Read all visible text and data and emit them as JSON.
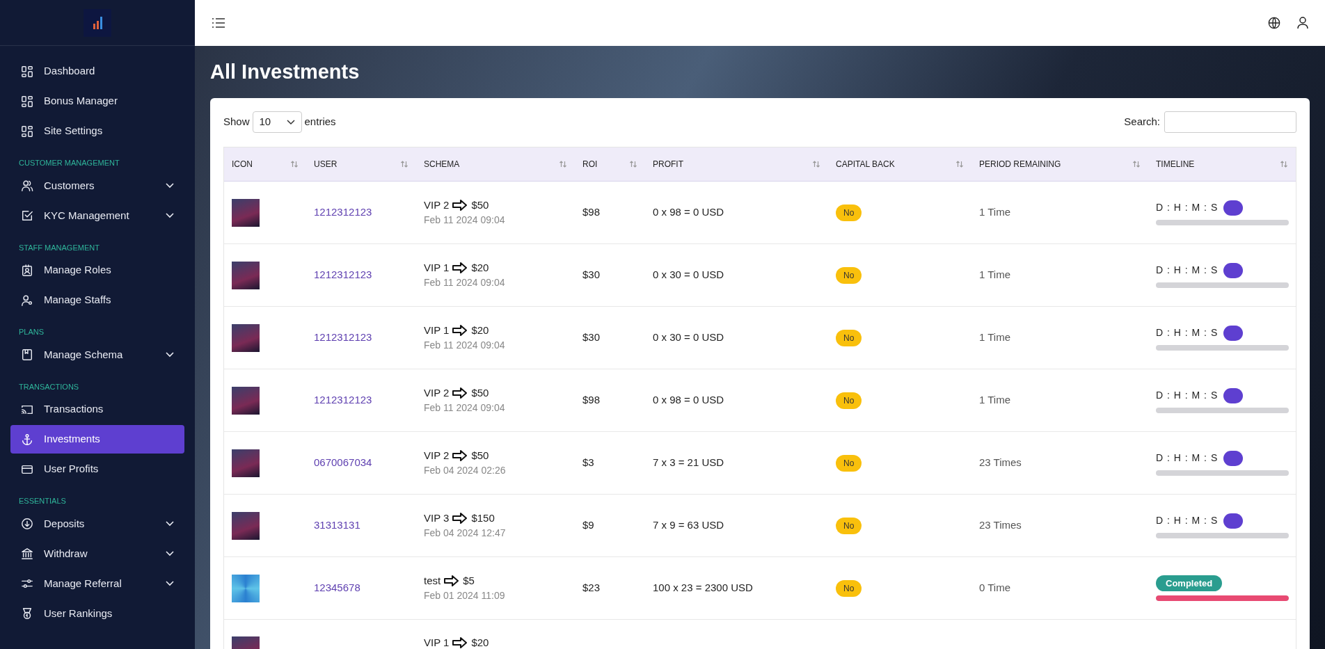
{
  "sidebar": {
    "items": [
      {
        "kind": "link",
        "label": "Dashboard",
        "selected": false
      },
      {
        "kind": "link",
        "label": "Bonus Manager",
        "selected": false
      },
      {
        "kind": "link",
        "label": "Site Settings",
        "selected": false
      },
      {
        "kind": "section",
        "label": "CUSTOMER MANAGEMENT"
      },
      {
        "kind": "link",
        "label": "Customers",
        "selected": false,
        "expandable": true
      },
      {
        "kind": "link",
        "label": "KYC Management",
        "selected": false,
        "expandable": true
      },
      {
        "kind": "section",
        "label": "STAFF MANAGEMENT"
      },
      {
        "kind": "link",
        "label": "Manage Roles",
        "selected": false
      },
      {
        "kind": "link",
        "label": "Manage Staffs",
        "selected": false
      },
      {
        "kind": "section",
        "label": "PLANS"
      },
      {
        "kind": "link",
        "label": "Manage Schema",
        "selected": false,
        "expandable": true
      },
      {
        "kind": "section",
        "label": "TRANSACTIONS"
      },
      {
        "kind": "link",
        "label": "Transactions",
        "selected": false
      },
      {
        "kind": "link",
        "label": "Investments",
        "selected": true
      },
      {
        "kind": "link",
        "label": "User Profits",
        "selected": false
      },
      {
        "kind": "section",
        "label": "ESSENTIALS"
      },
      {
        "kind": "link",
        "label": "Deposits",
        "selected": false,
        "expandable": true
      },
      {
        "kind": "link",
        "label": "Withdraw",
        "selected": false,
        "expandable": true
      },
      {
        "kind": "link",
        "label": "Manage Referral",
        "selected": false,
        "expandable": true
      },
      {
        "kind": "link",
        "label": "User Rankings",
        "selected": false
      }
    ]
  },
  "page": {
    "title": "All Investments"
  },
  "table_controls": {
    "show_label": "Show",
    "page_size": "10",
    "entries_label": "entries",
    "search_label": "Search:"
  },
  "table": {
    "columns": [
      "ICON",
      "USER",
      "SCHEMA",
      "ROI",
      "PROFIT",
      "CAPITAL BACK",
      "PERIOD REMAINING",
      "TIMELINE"
    ],
    "rows": [
      {
        "kind": "robot",
        "user": "1212312123",
        "schema": "VIP 2",
        "amount": "$50",
        "date": "Feb 11 2024 09:04",
        "roi": "$98",
        "profit": "0 x 98 = 0 USD",
        "capital_back": "No",
        "period": "1 Time",
        "timeline": {
          "kind": "countdown",
          "label": "D : H : M : S",
          "level": 0
        }
      },
      {
        "kind": "robot",
        "user": "1212312123",
        "schema": "VIP 1",
        "amount": "$20",
        "date": "Feb 11 2024 09:04",
        "roi": "$30",
        "profit": "0 x 30 = 0 USD",
        "capital_back": "No",
        "period": "1 Time",
        "timeline": {
          "kind": "countdown",
          "label": "D : H : M : S",
          "level": 0
        }
      },
      {
        "kind": "robot",
        "user": "1212312123",
        "schema": "VIP 1",
        "amount": "$20",
        "date": "Feb 11 2024 09:04",
        "roi": "$30",
        "profit": "0 x 30 = 0 USD",
        "capital_back": "No",
        "period": "1 Time",
        "timeline": {
          "kind": "countdown",
          "label": "D : H : M : S",
          "level": 0
        }
      },
      {
        "kind": "robot",
        "user": "1212312123",
        "schema": "VIP 2",
        "amount": "$50",
        "date": "Feb 11 2024 09:04",
        "roi": "$98",
        "profit": "0 x 98 = 0 USD",
        "capital_back": "No",
        "period": "1 Time",
        "timeline": {
          "kind": "countdown",
          "label": "D : H : M : S",
          "level": 0
        }
      },
      {
        "kind": "robot",
        "user": "0670067034",
        "schema": "VIP 2",
        "amount": "$50",
        "date": "Feb 04 2024 02:26",
        "roi": "$3",
        "profit": "7 x 3 = 21 USD",
        "capital_back": "No",
        "period": "23 Times",
        "timeline": {
          "kind": "countdown",
          "label": "D : H : M : S",
          "level": 0
        }
      },
      {
        "kind": "robot",
        "user": "31313131",
        "schema": "VIP 3",
        "amount": "$150",
        "date": "Feb 04 2024 12:47",
        "roi": "$9",
        "profit": "7 x 9 = 63 USD",
        "capital_back": "No",
        "period": "23 Times",
        "timeline": {
          "kind": "countdown",
          "label": "D : H : M : S",
          "level": 0
        }
      },
      {
        "kind": "swirl",
        "user": "12345678",
        "schema": "test",
        "amount": "$5",
        "date": "Feb 01 2024 11:09",
        "roi": "$23",
        "profit": "100 x 23 = 2300 USD",
        "capital_back": "No",
        "period": "0 Time",
        "timeline": {
          "kind": "completed",
          "label": "Completed",
          "level": 1
        }
      },
      {
        "kind": "partial",
        "schema": "VIP 1",
        "amount": "$20"
      }
    ]
  }
}
